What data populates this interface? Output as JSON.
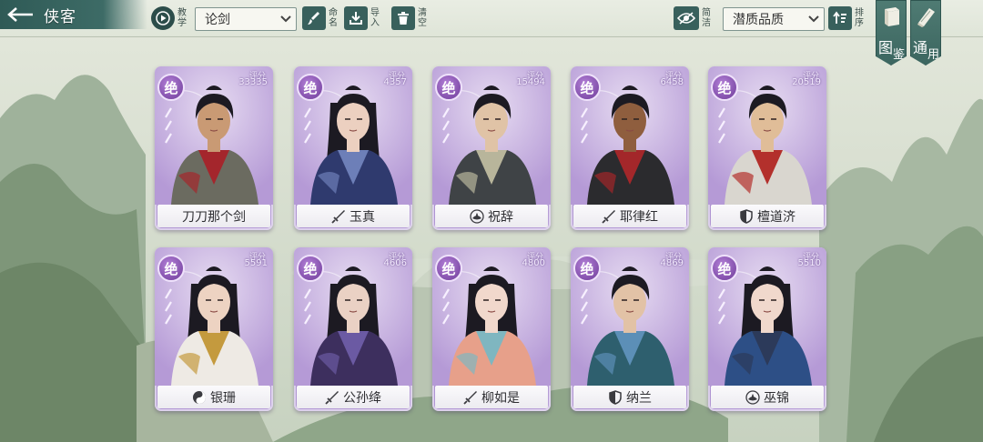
{
  "header": {
    "title": "侠客",
    "tutorial_label": "教学",
    "filter_value": "论剑",
    "rename_label": "命名",
    "import_label": "导入",
    "clear_label": "清空",
    "simplify_label": "简洁",
    "quality_value": "潜质品质",
    "sort_label": "排序"
  },
  "side_tabs": [
    {
      "c1": "图",
      "c2": "鉴",
      "icon": "book-icon"
    },
    {
      "c1": "通",
      "c2": "用",
      "icon": "scroll-icon"
    }
  ],
  "rank_label": "绝",
  "score_label": "评分",
  "cards": [
    {
      "name": "刀刀那个剑",
      "score": "33335",
      "faction_icon": "none",
      "robe": "#6b6b60",
      "accent": "#a4262c",
      "skin": "#c99a74"
    },
    {
      "name": "玉真",
      "score": "4357",
      "faction_icon": "sword-icon",
      "robe": "#2f3a6e",
      "accent": "#6d7fb8",
      "skin": "#ecd0c0"
    },
    {
      "name": "祝辞",
      "score": "15494",
      "faction_icon": "lotus-icon",
      "robe": "#3f4346",
      "accent": "#b8b59b",
      "skin": "#e0c3a6"
    },
    {
      "name": "耶律红",
      "score": "6458",
      "faction_icon": "sword-icon",
      "robe": "#2b2b2e",
      "accent": "#a3272a",
      "skin": "#8f5e3e"
    },
    {
      "name": "檀道济",
      "score": "20519",
      "faction_icon": "shield-icon",
      "robe": "#d9d6cf",
      "accent": "#b3302c",
      "skin": "#e0bd98"
    },
    {
      "name": "银珊",
      "score": "5591",
      "faction_icon": "yinyang-icon",
      "robe": "#eeeae4",
      "accent": "#c49a3e",
      "skin": "#edd3c2"
    },
    {
      "name": "公孙绛",
      "score": "4606",
      "faction_icon": "sword-icon",
      "robe": "#3d2f5e",
      "accent": "#6b5aa3",
      "skin": "#ead1c4"
    },
    {
      "name": "柳如是",
      "score": "4800",
      "faction_icon": "sword-icon",
      "robe": "#e7a08a",
      "accent": "#7fb6c0",
      "skin": "#f1d8cc"
    },
    {
      "name": "纳兰",
      "score": "4869",
      "faction_icon": "shield-icon",
      "robe": "#2e5f6e",
      "accent": "#5c8fb7",
      "skin": "#e2c2a6"
    },
    {
      "name": "巫锦",
      "score": "5510",
      "faction_icon": "lotus-icon",
      "robe": "#2d4f86",
      "accent": "#2c3a5a",
      "skin": "#f0d8cc"
    }
  ]
}
